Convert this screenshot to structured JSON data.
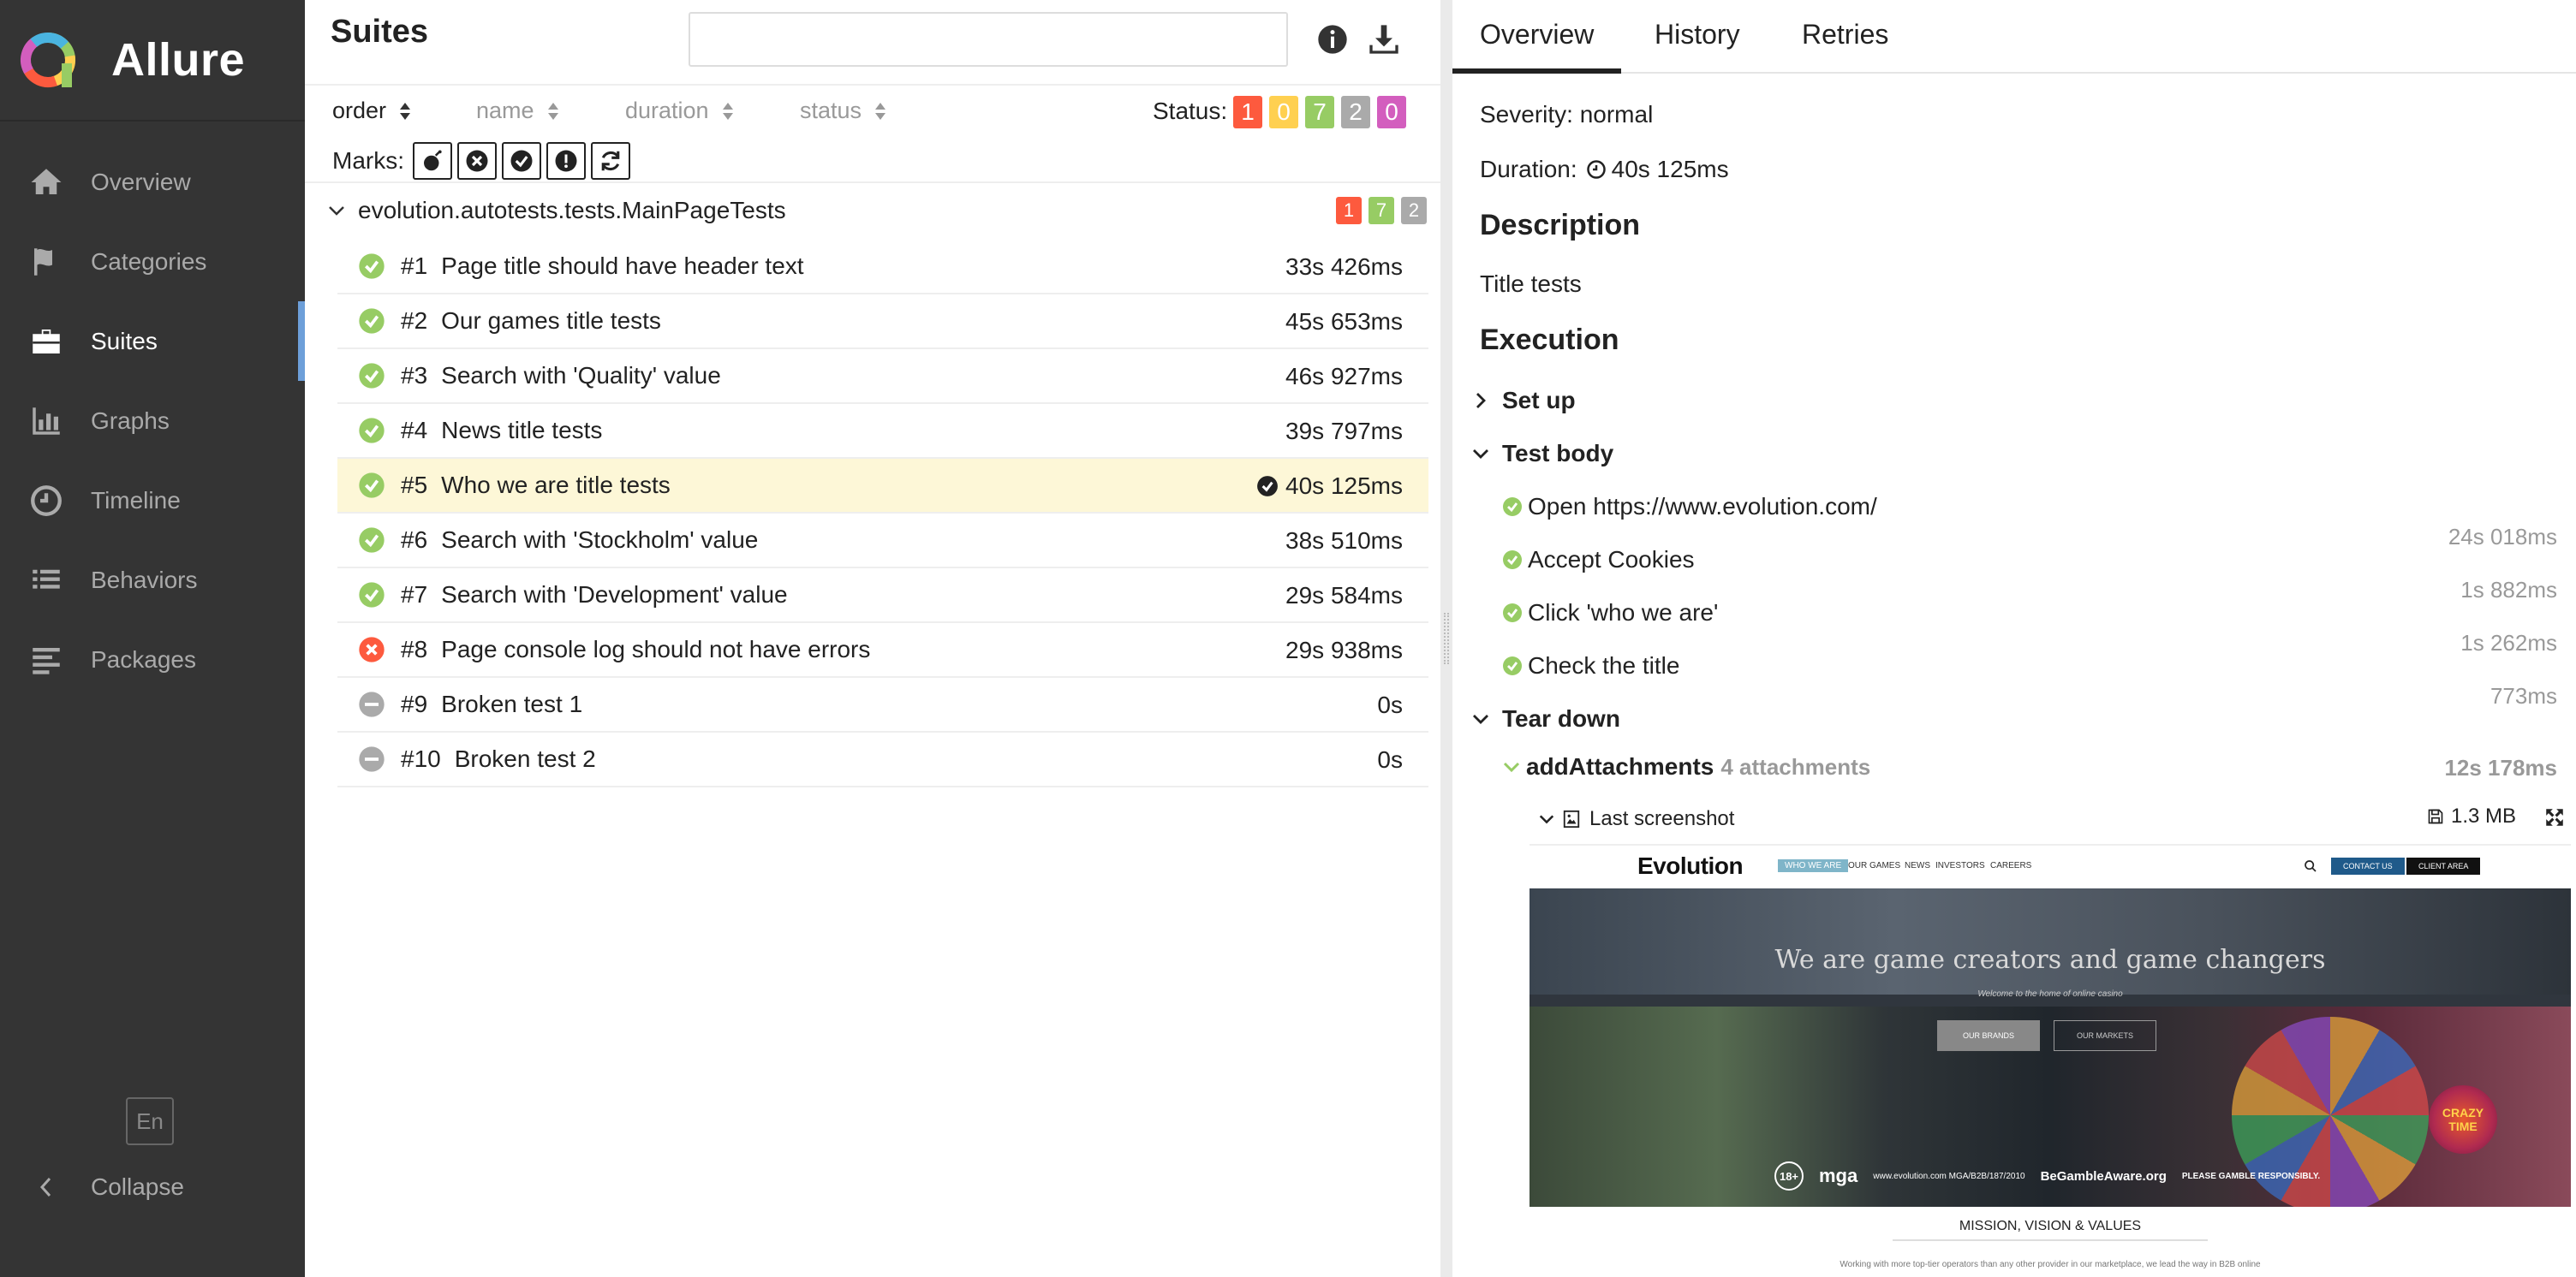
{
  "app": {
    "brand": "Allure",
    "colors": {
      "sidebar": "#343434",
      "accent": "#6d9fd9",
      "failed": "#fd5a3e",
      "broken": "#ffd050",
      "passed": "#97cc64",
      "skipped": "#aaaaaa",
      "unknown": "#d35ebe"
    }
  },
  "sidebar": {
    "items": [
      {
        "label": "Overview",
        "icon": "home-icon"
      },
      {
        "label": "Categories",
        "icon": "flag-icon"
      },
      {
        "label": "Suites",
        "icon": "briefcase-icon",
        "active": true
      },
      {
        "label": "Graphs",
        "icon": "bar-chart-icon"
      },
      {
        "label": "Timeline",
        "icon": "clock-icon"
      },
      {
        "label": "Behaviors",
        "icon": "list-icon"
      },
      {
        "label": "Packages",
        "icon": "align-left-icon"
      }
    ],
    "language": "En",
    "collapse": "Collapse"
  },
  "suites": {
    "title": "Suites",
    "search_value": "",
    "sort": {
      "order": "order",
      "name": "name",
      "duration": "duration",
      "status": "status"
    },
    "status_label": "Status:",
    "status_counts": {
      "failed": "1",
      "broken": "0",
      "passed": "7",
      "skipped": "2",
      "unknown": "0"
    },
    "marks_label": "Marks:",
    "suite_name": "evolution.autotests.tests.MainPageTests",
    "suite_counts": {
      "failed": "1",
      "passed": "7",
      "skipped": "2"
    },
    "tests": [
      {
        "num": "#1",
        "name": "Page title should have header text",
        "duration": "33s 426ms",
        "status": "passed"
      },
      {
        "num": "#2",
        "name": "Our games title tests",
        "duration": "45s 653ms",
        "status": "passed"
      },
      {
        "num": "#3",
        "name": "Search with 'Quality' value",
        "duration": "46s 927ms",
        "status": "passed"
      },
      {
        "num": "#4",
        "name": "News title tests",
        "duration": "39s 797ms",
        "status": "passed"
      },
      {
        "num": "#5",
        "name": "Who we are title tests",
        "duration": "40s 125ms",
        "status": "passed",
        "selected": true
      },
      {
        "num": "#6",
        "name": "Search with 'Stockholm' value",
        "duration": "38s 510ms",
        "status": "passed"
      },
      {
        "num": "#7",
        "name": "Search with 'Development' value",
        "duration": "29s 584ms",
        "status": "passed"
      },
      {
        "num": "#8",
        "name": "Page console log should not have errors",
        "duration": "29s 938ms",
        "status": "failed"
      },
      {
        "num": "#9",
        "name": "Broken test 1",
        "duration": "0s",
        "status": "skipped"
      },
      {
        "num": "#10",
        "name": "Broken test 2",
        "duration": "0s",
        "status": "skipped"
      }
    ]
  },
  "details": {
    "tabs": [
      "Overview",
      "History",
      "Retries"
    ],
    "severity": "Severity: normal",
    "duration_label": "Duration:",
    "duration_value": "40s 125ms",
    "description_title": "Description",
    "description_text": "Title tests",
    "execution_title": "Execution",
    "setup": "Set up",
    "test_body": "Test body",
    "steps": [
      {
        "name": "Open https://www.evolution.com/",
        "time": "24s 018ms"
      },
      {
        "name": "Accept Cookies",
        "time": "1s 882ms"
      },
      {
        "name": "Click 'who we are'",
        "time": "1s 262ms"
      },
      {
        "name": "Check the title",
        "time": "773ms"
      }
    ],
    "tear_down": "Tear down",
    "attachment_step": "addAttachments",
    "attachment_count": "4 attachments",
    "attachment_time": "12s 178ms",
    "screenshot_name": "Last screenshot",
    "screenshot_size": "1.3 MB"
  },
  "embedded": {
    "logo": "Evolution",
    "nav": [
      "WHO WE ARE",
      "OUR GAMES",
      "NEWS",
      "INVESTORS",
      "CAREERS"
    ],
    "contact": "CONTACT US",
    "client": "CLIENT AREA",
    "headline": "We are game creators and game changers",
    "subheadline": "Welcome to the home of online casino",
    "btn_brands": "OUR BRANDS",
    "btn_markets": "OUR MARKETS",
    "badges": [
      "18+",
      "mga",
      "www.evolution.com MGA/B2B/187/2010",
      "BeGambleAware.org",
      "PLEASE GAMBLE RESPONSIBLY."
    ],
    "crazy": "CRAZY TIME",
    "mission": "MISSION, VISION & VALUES",
    "tagline": "Working with more top-tier operators than any other provider in our marketplace, we lead the way in B2B online"
  }
}
